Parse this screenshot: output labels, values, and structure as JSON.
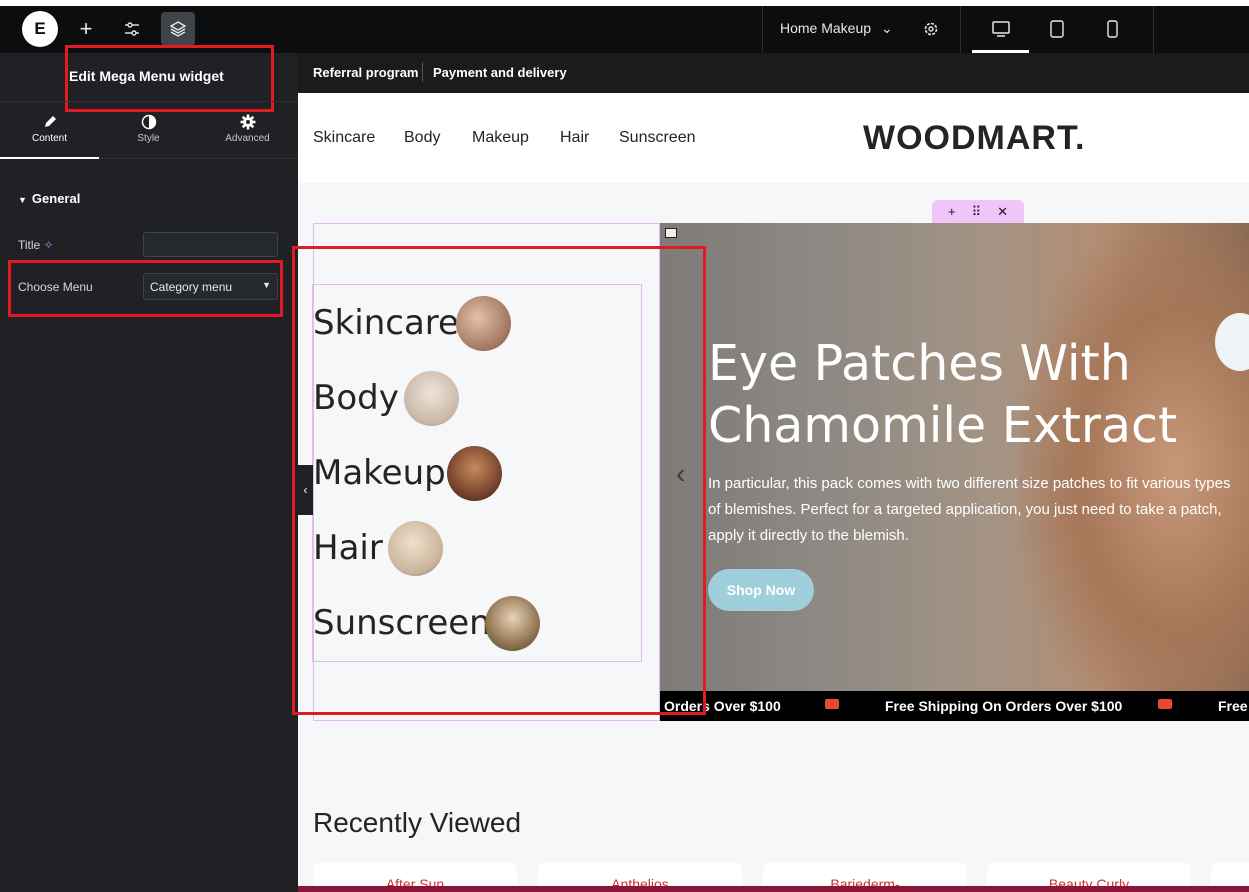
{
  "editor": {
    "add_label": "+",
    "page_name": "Home Makeup",
    "widget_title": "Edit Mega Menu widget",
    "tabs": [
      {
        "label": "Content"
      },
      {
        "label": "Style"
      },
      {
        "label": "Advanced"
      }
    ],
    "section": "General",
    "fields": {
      "title_label": "Title",
      "title_value": "",
      "choose_menu_label": "Choose Menu",
      "choose_menu_value": "Category menu"
    },
    "accent": "#e01b24"
  },
  "site": {
    "top_links": [
      "Referral program",
      "Payment and delivery"
    ],
    "nav": [
      "Skincare",
      "Body",
      "Makeup",
      "Hair",
      "Sunscreen"
    ],
    "brand": "WOODMART.",
    "mega_menu_items": [
      {
        "label": "Skincare",
        "thumb_color": "#a07560"
      },
      {
        "label": "Body",
        "thumb_color": "#c9b6a6"
      },
      {
        "label": "Makeup",
        "thumb_color": "#6b3b28"
      },
      {
        "label": "Hair",
        "thumb_color": "#cbb59c"
      },
      {
        "label": "Sunscreen",
        "thumb_color": "#8a6e4c"
      }
    ],
    "hero": {
      "title_line1": "Eye Patches With",
      "title_line2": "Chamomile Extract",
      "description": "In particular, this pack comes with two different size patches to fit various types of blemishes. Perfect for a targeted application, you just need to take a patch, apply it directly to the blemish.",
      "button": "Shop Now"
    },
    "marquee": [
      "Orders Over $100",
      "Free Shipping On Orders Over $100",
      "Free"
    ],
    "recently_viewed": "Recently Viewed",
    "products": [
      "After Sun",
      "Anthelios",
      "Bariederm-",
      "Beauty Curly"
    ]
  }
}
